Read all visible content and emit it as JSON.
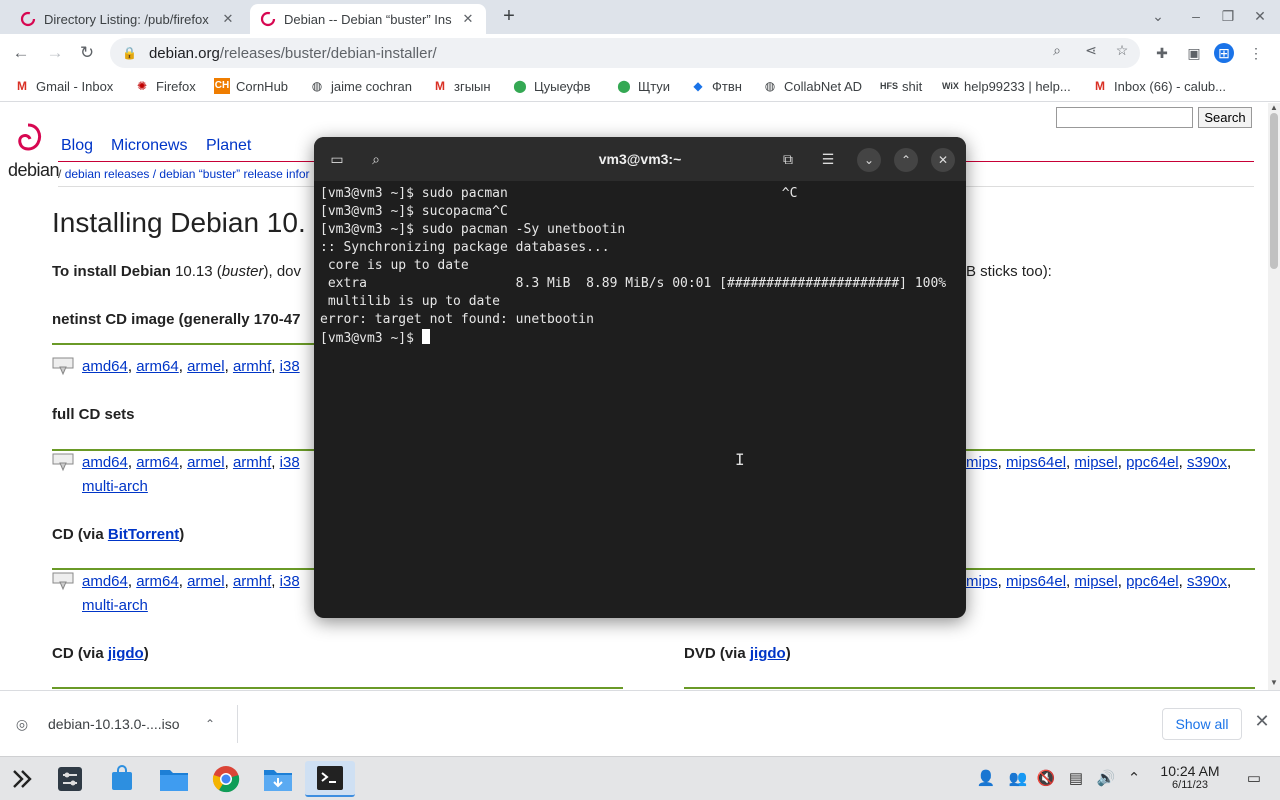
{
  "browser": {
    "tabs": [
      {
        "title": "Directory Listing: /pub/firefox",
        "active": false
      },
      {
        "title": "Debian -- Debian “buster” Ins",
        "active": true
      }
    ],
    "address": {
      "host": "debian.org",
      "path": "/releases/buster/debian-installer/"
    },
    "bookmarks": [
      {
        "label": "Gmail - Inbox",
        "icon": "gmail-icon",
        "color": "#d93025"
      },
      {
        "label": "Firefox",
        "icon": "firefox-icon",
        "color": "#c00000"
      },
      {
        "label": "CornHub",
        "icon": "cornhub-icon",
        "color": "#ef7d00"
      },
      {
        "label": "jaime cochran",
        "icon": "globe-icon",
        "color": "#333333"
      },
      {
        "label": "згыын",
        "icon": "gmail-icon",
        "color": "#d93025"
      },
      {
        "label": "Цуыеуфв",
        "icon": "maps-pin-icon",
        "color": "#34a853"
      },
      {
        "label": "Щтуи",
        "icon": "maps-pin-icon",
        "color": "#34a853"
      },
      {
        "label": "Фтвн",
        "icon": "diamond-icon",
        "color": "#1a73e8"
      },
      {
        "label": "CollabNet AD",
        "icon": "globe-icon",
        "color": "#333333"
      },
      {
        "label": "shit",
        "icon": "hfs-icon",
        "color": "#333333"
      },
      {
        "label": "help99233 | help...",
        "icon": "wix-icon",
        "color": "#000000"
      },
      {
        "label": "Inbox (66) - calub...",
        "icon": "gmail-icon",
        "color": "#d93025"
      }
    ]
  },
  "webpage": {
    "logo_text": "debian",
    "nav": [
      "Blog",
      "Micronews",
      "Planet"
    ],
    "search_button": "Search",
    "breadcrumb": {
      "sep": "/",
      "items": [
        "debian releases",
        "/ debian “buster” release infor"
      ]
    },
    "title": "Installing Debian 10.",
    "intro": {
      "bold": "To install Debian",
      "version": "10.13 (",
      "codename": "buster",
      "rest": "), dov",
      "tail": "B sticks too):"
    },
    "sections": {
      "netinst": "netinst CD image (generally 170-47",
      "full_cd": "full CD sets",
      "cd_bittorrent_prefix": "CD (via ",
      "cd_bittorrent_link": "BitTorrent",
      "cd_jigdo_prefix": "CD (via ",
      "jigdo": "jigdo",
      "dvd_jigdo_prefix": "DVD (via ",
      "close_paren": ")"
    },
    "arch_links_left": [
      "amd64",
      "arm64",
      "armel",
      "armhf",
      "i38"
    ],
    "arch_links_right": [
      "mips",
      "mips64el",
      "mipsel",
      "ppc64el",
      "s390x"
    ],
    "multi_arch": "multi-arch",
    "comma": ","
  },
  "terminal": {
    "title": "vm3@vm3:~",
    "lines": [
      "[vm3@vm3 ~]$ sudo pacman                                   ^C",
      "[vm3@vm3 ~]$ sucopacma^C",
      "[vm3@vm3 ~]$ sudo pacman -Sy unetbootin",
      ":: Synchronizing package databases...",
      " core is up to date",
      " extra                   8.3 MiB  8.89 MiB/s 00:01 [######################] 100%",
      " multilib is up to date",
      "error: target not found: unetbootin"
    ],
    "prompt": "[vm3@vm3 ~]$ "
  },
  "downloads": {
    "file": "debian-10.13.0-....iso",
    "show_all": "Show all"
  },
  "taskbar": {
    "time": "10:24 AM",
    "date": "6/11/23"
  }
}
